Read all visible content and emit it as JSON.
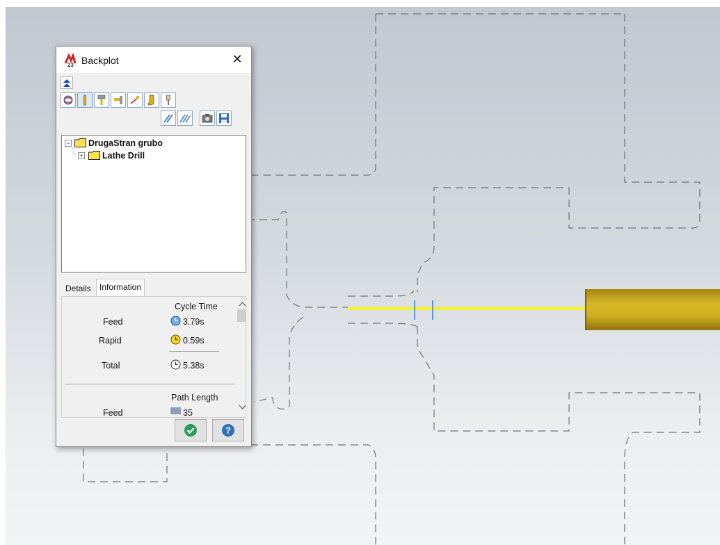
{
  "window": {
    "title": "Backplot",
    "close_glyph": "✕"
  },
  "toolbar": {
    "buttons": [
      "refresh-icon",
      "tool-icon",
      "holder-icon",
      "tool-holder-icon",
      "toolpath-icon",
      "stock-icon",
      "material-icon",
      "dynamic-toolpath-icon",
      "all-toolpath-icon",
      "screenshot-icon",
      "save-icon"
    ]
  },
  "tree": {
    "root_label": "DrugaStran grubo",
    "child_label": "Lathe Drill",
    "root_toggle": "−",
    "child_toggle": "+"
  },
  "tabs": {
    "details": "Details",
    "information": "Information"
  },
  "info": {
    "cycle_time_header": "Cycle Time",
    "feed_label": "Feed",
    "feed_value": "3.79s",
    "rapid_label": "Rapid",
    "rapid_value": "0.59s",
    "total_label": "Total",
    "total_value": "5.38s",
    "path_length_header": "Path Length",
    "feed2_label": "Feed",
    "feed2_value": "35"
  },
  "colors": {
    "toolpath": "#f5f31a",
    "tool_body": "#c9a614",
    "cut_marker": "#3a7bd5",
    "ok_button": "#2a9d5c",
    "help_button": "#2e6fb5"
  }
}
